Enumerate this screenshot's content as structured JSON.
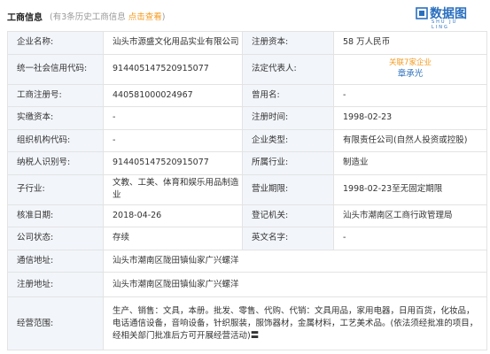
{
  "header": {
    "title": "工商信息",
    "sub_open": "(有3条历史工商信息 ",
    "link": "点击查看",
    "sub_close": ")"
  },
  "logo": {
    "text": "数据图",
    "sub": "SHU JU LING",
    "color": "#2a6fbe"
  },
  "rows": {
    "company_name_label": "企业名称:",
    "company_name": "汕头市源盛文化用品实业有限公司",
    "reg_capital_label": "注册资本:",
    "reg_capital": "58 万人民币",
    "credit_code_label": "统一社会信用代码:",
    "credit_code": "914405147520915077",
    "legal_rep_label": "法定代表人:",
    "legal_rep_tag": "关联7家企业",
    "legal_rep": "章承光",
    "biz_reg_label": "工商注册号:",
    "biz_reg": "440581000024967",
    "former_name_label": "曾用名:",
    "former_name": "-",
    "paid_capital_label": "实缴资本:",
    "paid_capital": "-",
    "reg_time_label": "注册时间:",
    "reg_time": "1998-02-23",
    "org_code_label": "组织机构代码:",
    "org_code": "-",
    "company_type_label": "企业类型:",
    "company_type": "有限责任公司(自然人投资或控股)",
    "taxpayer_label": "纳税人识别号:",
    "taxpayer": "914405147520915077",
    "industry_label": "所属行业:",
    "industry": "制造业",
    "sub_industry_label": "子行业:",
    "sub_industry": "文教、工美、体育和娱乐用品制造业",
    "biz_term_label": "营业期限:",
    "biz_term": "1998-02-23至无固定期限",
    "approval_date_label": "核准日期:",
    "approval_date": "2018-04-26",
    "reg_authority_label": "登记机关:",
    "reg_authority": "汕头市潮南区工商行政管理局",
    "status_label": "公司状态:",
    "status": "存续",
    "english_name_label": "英文名字:",
    "english_name": "-",
    "mail_address_label": "通信地址:",
    "mail_address": "汕头市潮南区陇田镇仙家广兴螺洋",
    "reg_address_label": "注册地址:",
    "reg_address": "汕头市潮南区陇田镇仙家广兴螺洋",
    "scope_label": "经营范围:",
    "scope": "生产、销售：文具，本册。批发、零售、代购、代销：文具用品，家用电器，日用百货，化妆品，电话通信设备，音响设备，针织服装，服饰器材，金属材料，工艺美术品。(依法须经批准的项目，经相关部门批准后方可开展经营活动)〓"
  }
}
